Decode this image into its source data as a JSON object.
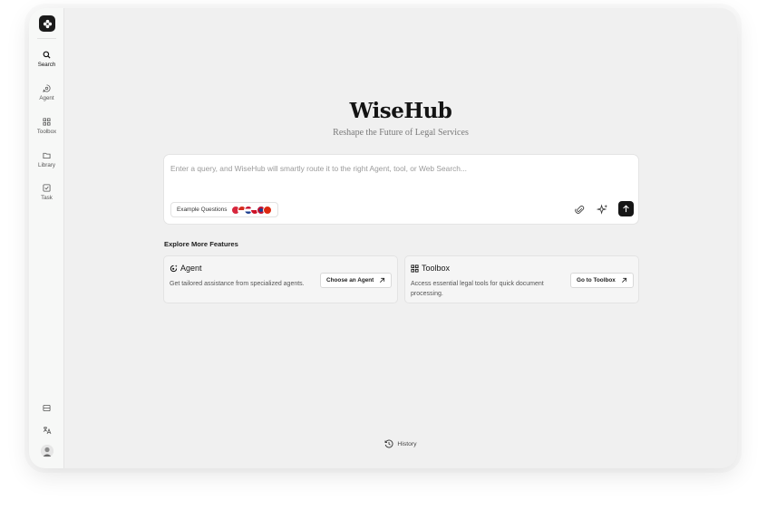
{
  "app": {
    "brand": "WiseHub",
    "tagline": "Reshape the Future of Legal Services"
  },
  "sidebar": {
    "items": [
      {
        "label": "Search",
        "icon": "search-icon",
        "active": true
      },
      {
        "label": "Agent",
        "icon": "agent-icon",
        "active": false
      },
      {
        "label": "Toolbox",
        "icon": "toolbox-icon",
        "active": false
      },
      {
        "label": "Library",
        "icon": "folder-icon",
        "active": false
      },
      {
        "label": "Task",
        "icon": "task-check-icon",
        "active": false
      }
    ],
    "utilities": [
      "panel-icon",
      "translate-icon"
    ],
    "avatar": "user-avatar"
  },
  "search": {
    "placeholder": "Enter a query, and WiseHub will smartly route it to the right Agent, tool, or Web Search...",
    "value": "",
    "example_label": "Example Questions",
    "actions": [
      "paperclip-icon",
      "sparkle-icon",
      "arrow-up-icon"
    ]
  },
  "explore": {
    "title": "Explore More Features",
    "cards": [
      {
        "title": "Agent",
        "icon": "agent-sparkle-icon",
        "description": "Get tailored assistance from specialized agents.",
        "button": "Choose an Agent"
      },
      {
        "title": "Toolbox",
        "icon": "toolbox-icon",
        "description": "Access essential legal tools for quick document processing.",
        "button": "Go to Toolbox"
      }
    ]
  },
  "footer": {
    "history_label": "History"
  },
  "colors": {
    "background": "#f0f0f0",
    "sidebar": "#f7f8f7",
    "accent": "#161616",
    "card": "#f5f5f5"
  }
}
